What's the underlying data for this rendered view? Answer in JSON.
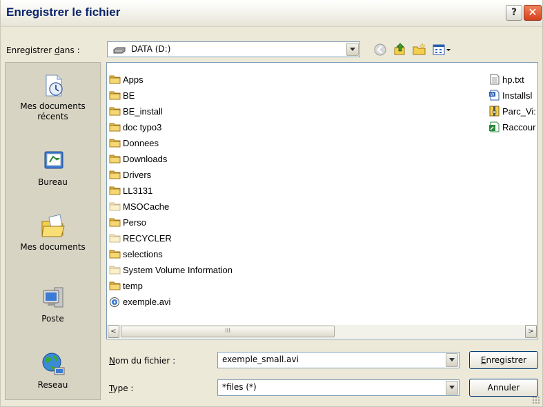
{
  "window": {
    "title": "Enregistrer le fichier",
    "help_label": "?",
    "close_label": "✕"
  },
  "save_in": {
    "label_pre": "Enregistrer ",
    "label_key": "d",
    "label_post": "ans :",
    "value": "DATA (D:)"
  },
  "toolbar": {
    "icons": [
      "back-icon",
      "up-folder-icon",
      "new-folder-icon",
      "view-menu-icon"
    ]
  },
  "places": [
    {
      "label": "Mes documents récents",
      "icon": "recent-documents-icon"
    },
    {
      "label": "Bureau",
      "icon": "desktop-icon"
    },
    {
      "label": "Mes documents",
      "icon": "my-documents-icon"
    },
    {
      "label": "Poste",
      "icon": "computer-icon"
    },
    {
      "label": "Reseau",
      "icon": "network-icon"
    }
  ],
  "files_col1": [
    {
      "name": "Apps",
      "kind": "folder"
    },
    {
      "name": "BE",
      "kind": "folder"
    },
    {
      "name": "BE_install",
      "kind": "folder"
    },
    {
      "name": "doc typo3",
      "kind": "folder"
    },
    {
      "name": "Donnees",
      "kind": "folder"
    },
    {
      "name": "Downloads",
      "kind": "folder"
    },
    {
      "name": "Drivers",
      "kind": "folder"
    },
    {
      "name": "LL3131",
      "kind": "folder"
    },
    {
      "name": "MSOCache",
      "kind": "folder-hidden"
    },
    {
      "name": "Perso",
      "kind": "folder"
    },
    {
      "name": "RECYCLER",
      "kind": "folder-hidden"
    },
    {
      "name": "selections",
      "kind": "folder"
    },
    {
      "name": "System Volume Information",
      "kind": "folder-hidden"
    },
    {
      "name": "temp",
      "kind": "folder"
    },
    {
      "name": "exemple.avi",
      "kind": "video"
    }
  ],
  "files_col2": [
    {
      "name": "hp.txt",
      "kind": "text"
    },
    {
      "name": "Installsl",
      "kind": "word"
    },
    {
      "name": "Parc_Vi:",
      "kind": "archive"
    },
    {
      "name": "Raccour",
      "kind": "sheet"
    }
  ],
  "scrollbar": {
    "left": "<",
    "right": ">",
    "grip": "III"
  },
  "filename": {
    "label_key": "N",
    "label_post": "om du fichier :",
    "value": "exemple_small.avi"
  },
  "type": {
    "label_key": "T",
    "label_post": "ype :",
    "value": "*files (*)"
  },
  "buttons": {
    "save_key": "E",
    "save_post": "nregistrer",
    "cancel": "Annuler"
  }
}
